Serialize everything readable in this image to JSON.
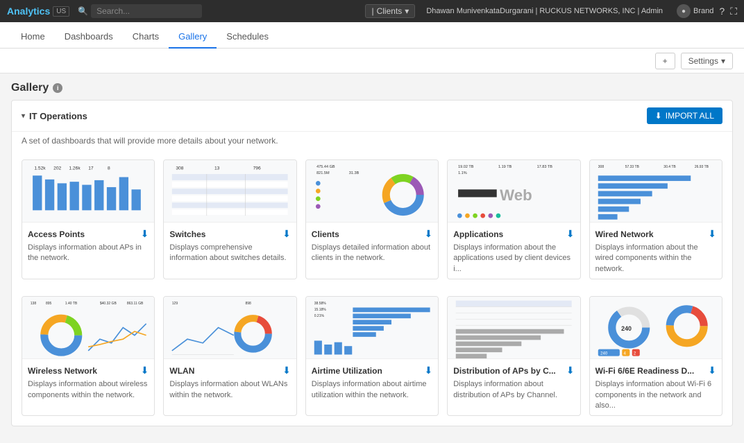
{
  "topbar": {
    "logo": "Analytics",
    "region": "US",
    "search_placeholder": "Search...",
    "client_selector": "Clients",
    "user_info": "Dhawan MunivenkataDurgarani | RUCKUS NETWORKS, INC | Admin",
    "brand_label": "Brand"
  },
  "secnav": {
    "items": [
      {
        "label": "Home",
        "active": false
      },
      {
        "label": "Dashboards",
        "active": false
      },
      {
        "label": "Charts",
        "active": false
      },
      {
        "label": "Gallery",
        "active": true
      },
      {
        "label": "Schedules",
        "active": false
      }
    ]
  },
  "toolbar": {
    "plus_label": "+",
    "settings_label": "Settings"
  },
  "page": {
    "title": "Gallery",
    "section_chevron": "▾",
    "section_title": "IT Operations",
    "section_desc": "A set of dashboards that will provide more details about your network.",
    "import_all_label": "IMPORT ALL"
  },
  "cards_row1": [
    {
      "title": "Access Points",
      "desc": "Displays information about APs in the network.",
      "thumb_type": "bar"
    },
    {
      "title": "Switches",
      "desc": "Displays comprehensive information about switches details.",
      "thumb_type": "table"
    },
    {
      "title": "Clients",
      "desc": "Displays detailed information about clients in the network.",
      "thumb_type": "donut"
    },
    {
      "title": "Applications",
      "desc": "Displays information about the applications used by client devices i...",
      "thumb_type": "web"
    },
    {
      "title": "Wired Network",
      "desc": "Displays information about the wired components within the network.",
      "thumb_type": "barh"
    }
  ],
  "cards_row2": [
    {
      "title": "Wireless Network",
      "desc": "Displays information about wireless components within the network.",
      "thumb_type": "donut2"
    },
    {
      "title": "WLAN",
      "desc": "Displays information about WLANs within the network.",
      "thumb_type": "donut3"
    },
    {
      "title": "Airtime Utilization",
      "desc": "Displays information about airtime utilization within the network.",
      "thumb_type": "barh2"
    },
    {
      "title": "Distribution of APs by C...",
      "desc": "Displays information about distribution of APs by Channel.",
      "thumb_type": "barh3"
    },
    {
      "title": "Wi-Fi 6/6E Readiness D...",
      "desc": "Displays information about Wi-Fi 6 components in the network and also...",
      "thumb_type": "donut4"
    }
  ]
}
